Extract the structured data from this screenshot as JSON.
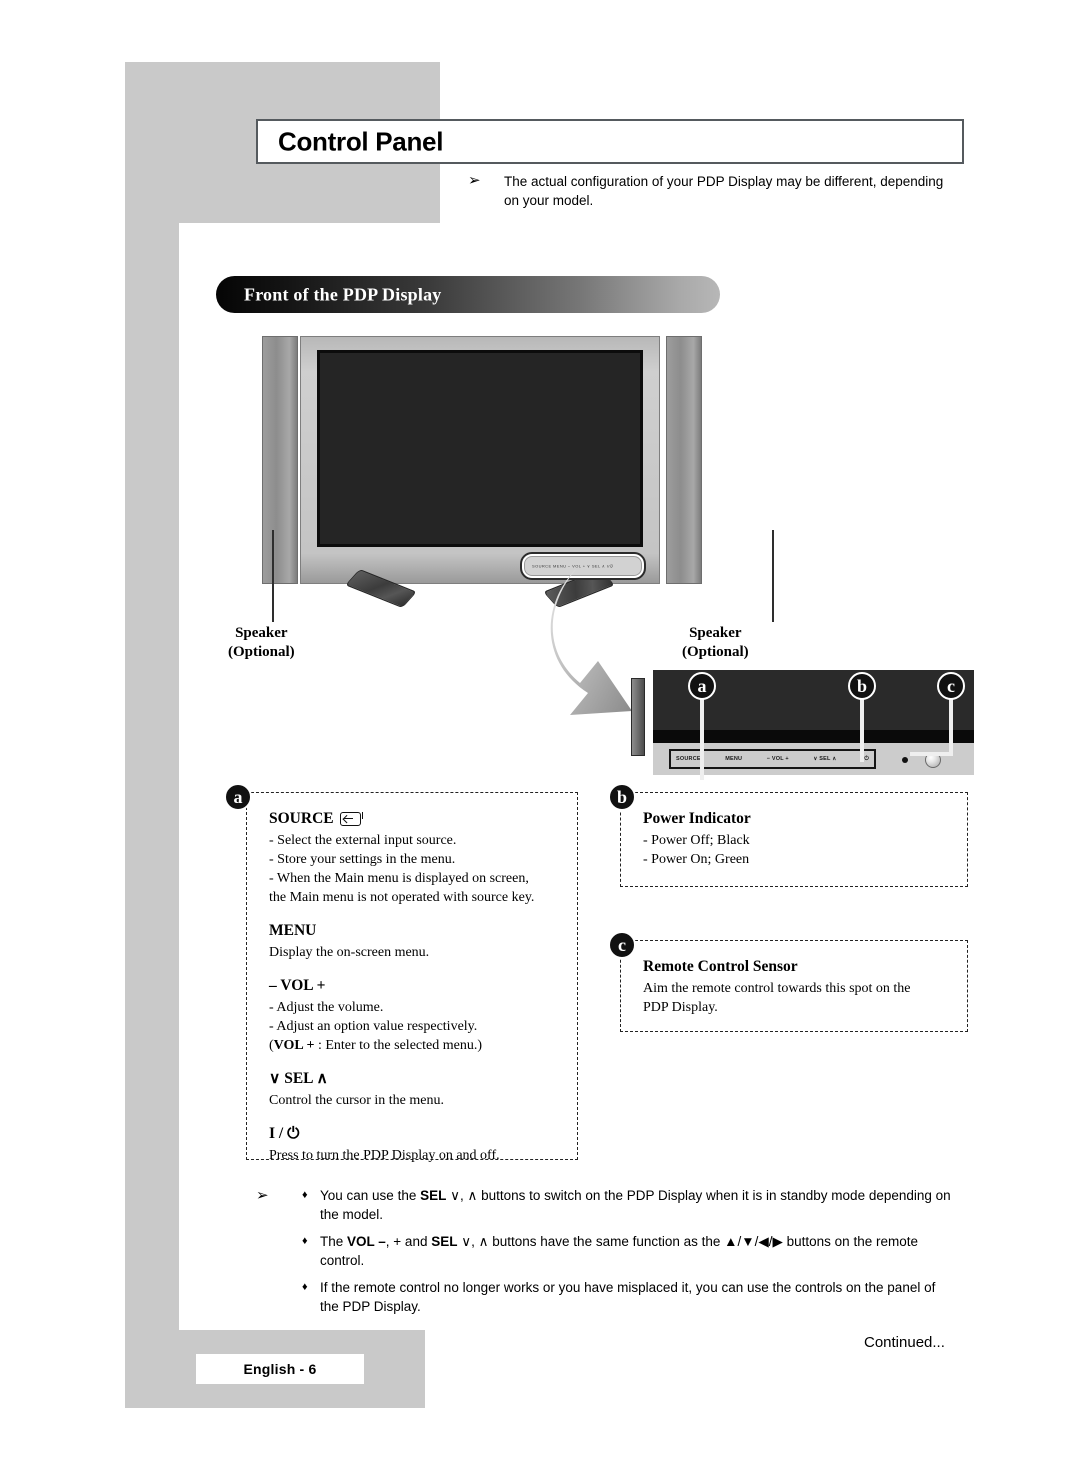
{
  "page": {
    "chapter_title": "Control Panel",
    "page_tag": "English - 6",
    "continued_label": "Continued...",
    "arrow_glyph": "➢"
  },
  "top_note": {
    "text": "The actual configuration of your PDP Display may be different, depending on your model."
  },
  "section": {
    "banner_title": "Front of the PDP Display"
  },
  "figure": {
    "speaker_left": {
      "line1": "Speaker",
      "line2": "(Optional)"
    },
    "speaker_right": {
      "line1": "Speaker",
      "line2": "(Optional)"
    },
    "strip_marks": "SOURCE  MENU  −  VOL  +    ∨ SEL ∧    I/⏻"
  },
  "callout": {
    "markers": {
      "a": "a",
      "b": "b",
      "c": "c"
    },
    "buttons": [
      "SOURCE",
      "MENU",
      "−  VOL  +",
      "∨  SEL  ∧",
      "I/⏻"
    ]
  },
  "box_a": {
    "marker": "a",
    "groups": [
      {
        "heading": "SOURCE",
        "has_source_icon": true,
        "lines": [
          "- Select the external input source.",
          "- Store your settings in the menu.",
          "- When the Main menu is displayed on screen,",
          "   the Main menu is not operated with source key."
        ]
      },
      {
        "heading": "MENU",
        "lines": [
          "Display the on-screen menu."
        ]
      },
      {
        "heading": "– VOL +",
        "lines": [
          "- Adjust the volume.",
          "- Adjust an option value respectively.",
          "(VOL + : Enter to the selected menu.)"
        ],
        "bold_prefix_line3": "VOL +",
        "rest_line3": " : Enter to the selected menu.)"
      },
      {
        "heading": "∨ SEL ∧",
        "lines": [
          "Control the cursor in the menu."
        ]
      },
      {
        "heading": "I / ⏻",
        "lines": [
          "Press to turn the PDP Display on and off."
        ]
      }
    ]
  },
  "box_b": {
    "marker": "b",
    "heading": "Power Indicator",
    "lines": [
      "- Power Off; Black",
      "- Power On; Green"
    ]
  },
  "box_c": {
    "marker": "c",
    "heading": "Remote Control Sensor",
    "lines": [
      "Aim the remote control towards this spot on the",
      "PDP Display."
    ]
  },
  "bottom_notes": [
    {
      "bullet": "♦",
      "segments": [
        {
          "t": "You can use the ",
          "b": false
        },
        {
          "t": "SEL",
          "b": true
        },
        {
          "t": "  ∨, ∧  buttons to switch on the PDP Display when it is in standby mode depending on the model.",
          "b": false
        }
      ]
    },
    {
      "bullet": "♦",
      "segments": [
        {
          "t": "The ",
          "b": false
        },
        {
          "t": "VOL –",
          "b": true
        },
        {
          "t": ", + and ",
          "b": false
        },
        {
          "t": "SEL",
          "b": true
        },
        {
          "t": "  ∨, ∧  buttons have the same function as the ▲/▼/◀/▶ buttons on the remote control.",
          "b": false
        }
      ]
    },
    {
      "bullet": "♦",
      "segments": [
        {
          "t": "If the remote control no longer works or you have misplaced it, you can use the controls on the panel of the PDP Display.",
          "b": false
        }
      ]
    }
  ],
  "colors": {
    "page_gray": "#c9c9c9",
    "banner_dark": "#050505",
    "banner_light": "#b7b7b7",
    "ink": "#000000"
  }
}
